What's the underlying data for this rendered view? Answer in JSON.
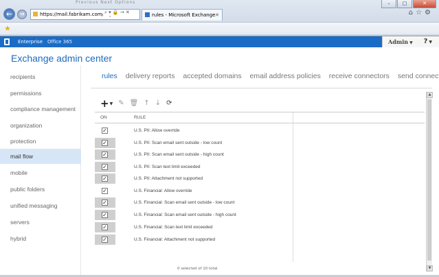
{
  "browser": {
    "address": "https://mail.fabrikam.com/ecp",
    "address_tools": "⌕ ▾ 🔒 → ✕",
    "tab_title": "rules - Microsoft Exchange",
    "tab_close": "✕",
    "window_buttons": [
      "–",
      "□",
      "✕"
    ],
    "icons": [
      "home-icon",
      "star-icon",
      "gear-icon"
    ]
  },
  "o365": {
    "nav_enterprise": "Enterprise",
    "nav_office365": "Office 365",
    "user": "Admin",
    "help": "?"
  },
  "app_title": "Exchange admin center",
  "sidebar": {
    "items": [
      {
        "label": "recipients"
      },
      {
        "label": "permissions"
      },
      {
        "label": "compliance management"
      },
      {
        "label": "organization"
      },
      {
        "label": "protection"
      },
      {
        "label": "mail flow",
        "active": true
      },
      {
        "label": "mobile"
      },
      {
        "label": "public folders"
      },
      {
        "label": "unified messaging"
      },
      {
        "label": "servers"
      },
      {
        "label": "hybrid"
      }
    ]
  },
  "tabs": [
    "rules",
    "delivery reports",
    "accepted domains",
    "email address policies",
    "receive connectors",
    "send connectors"
  ],
  "toolbar": {
    "icons": [
      "add-icon",
      "edit-icon",
      "delete-icon",
      "move-up-icon",
      "move-down-icon",
      "refresh-icon"
    ]
  },
  "grid": {
    "columns": [
      "ON",
      "RULE"
    ],
    "rows": [
      {
        "on": true,
        "rule": "U.S. PII: Allow override",
        "shaded": false
      },
      {
        "on": true,
        "rule": "U.S. PII: Scan email sent outside - low count",
        "shaded": true
      },
      {
        "on": true,
        "rule": "U.S. PII: Scan email sent outside - high count",
        "shaded": true
      },
      {
        "on": true,
        "rule": "U.S. PII: Scan text limit exceeded",
        "shaded": true
      },
      {
        "on": true,
        "rule": "U.S. PII: Attachment not supported",
        "shaded": true
      },
      {
        "on": true,
        "rule": "U.S. Financial: Allow override",
        "shaded": false
      },
      {
        "on": true,
        "rule": "U.S. Financial: Scan email sent outside - low count",
        "shaded": true
      },
      {
        "on": true,
        "rule": "U.S. Financial: Scan email sent outside - high count",
        "shaded": true
      },
      {
        "on": true,
        "rule": "U.S. Financial: Scan text limit exceeded",
        "shaded": true
      },
      {
        "on": true,
        "rule": "U.S. Financial: Attachment not supported",
        "shaded": true
      }
    ],
    "footer": "0 selected of 10 total"
  },
  "colors": {
    "o365_bar": "#1a6cc7",
    "title": "#1d6bbd",
    "active_nav_bg": "#d7e6f7"
  }
}
